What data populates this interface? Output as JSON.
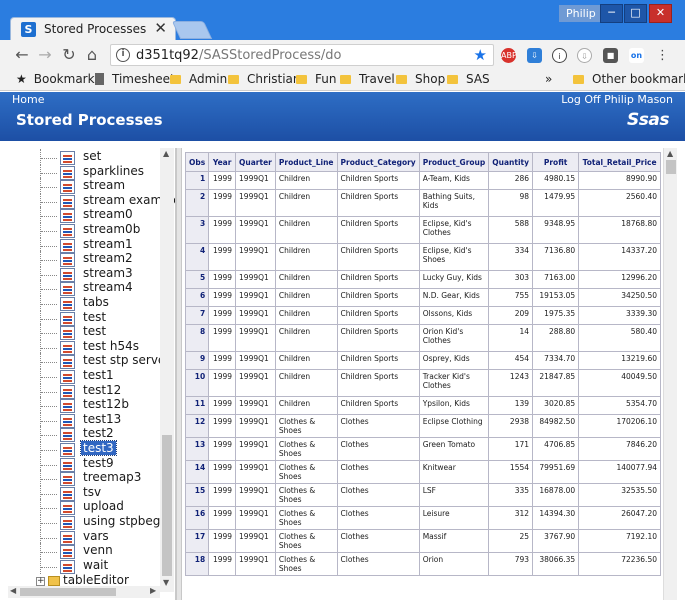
{
  "browser": {
    "tab_title": "Stored Processes",
    "tab_close": "✕",
    "favicon_letter": "S",
    "user": "Philip",
    "url_host": "d351tq92",
    "url_path": "/SASStoredProcess/do",
    "window_controls": [
      "minimize",
      "maximize",
      "close"
    ],
    "nav_icons": [
      "back-arrow-icon",
      "forward-arrow-icon",
      "reload-icon",
      "home-icon"
    ],
    "extensions": [
      "abp-icon",
      "download-icon",
      "info-icon",
      "clock-icon",
      "square-icon",
      "on-icon",
      "menu-icon"
    ]
  },
  "bookmarks": {
    "items": [
      "Bookmarks",
      "Timesheet",
      "Admin",
      "Christian",
      "Fun",
      "Travel",
      "Shop",
      "SAS"
    ],
    "overflow": "»",
    "other": "Other bookmarks"
  },
  "sas": {
    "home_link": "Home",
    "logoff_link": "Log Off Philip Mason",
    "title": "Stored Processes",
    "logo": "Ssas"
  },
  "tree": {
    "items": [
      "set",
      "sparklines",
      "stream",
      "stream example",
      "stream0",
      "stream0b",
      "stream1",
      "stream2",
      "stream3",
      "stream4",
      "tabs",
      "test",
      "test",
      "test h54s",
      "test stp server",
      "test1",
      "test12",
      "test12b",
      "test13",
      "test2",
      "test3",
      "test9",
      "treemap3",
      "tsv",
      "upload",
      "using stpbegin m",
      "vars",
      "venn",
      "wait"
    ],
    "selected": "test3",
    "folder": "tableEditor"
  },
  "table": {
    "columns": [
      "Obs",
      "Year",
      "Quarter",
      "Product_Line",
      "Product_Category",
      "Product_Group",
      "Quantity",
      "Profit",
      "Total_Retail_Price"
    ],
    "rows": [
      [
        "1",
        "1999",
        "1999Q1",
        "Children",
        "Children Sports",
        "A-Team, Kids",
        "286",
        "4980.15",
        "8990.90"
      ],
      [
        "2",
        "1999",
        "1999Q1",
        "Children",
        "Children Sports",
        "Bathing Suits, Kids",
        "98",
        "1479.95",
        "2560.40"
      ],
      [
        "3",
        "1999",
        "1999Q1",
        "Children",
        "Children Sports",
        "Eclipse, Kid's Clothes",
        "588",
        "9348.95",
        "18768.80"
      ],
      [
        "4",
        "1999",
        "1999Q1",
        "Children",
        "Children Sports",
        "Eclipse, Kid's Shoes",
        "334",
        "7136.80",
        "14337.20"
      ],
      [
        "5",
        "1999",
        "1999Q1",
        "Children",
        "Children Sports",
        "Lucky Guy, Kids",
        "303",
        "7163.00",
        "12996.20"
      ],
      [
        "6",
        "1999",
        "1999Q1",
        "Children",
        "Children Sports",
        "N.D. Gear, Kids",
        "755",
        "19153.05",
        "34250.50"
      ],
      [
        "7",
        "1999",
        "1999Q1",
        "Children",
        "Children Sports",
        "Olssons, Kids",
        "209",
        "1975.35",
        "3339.30"
      ],
      [
        "8",
        "1999",
        "1999Q1",
        "Children",
        "Children Sports",
        "Orion Kid's Clothes",
        "14",
        "288.80",
        "580.40"
      ],
      [
        "9",
        "1999",
        "1999Q1",
        "Children",
        "Children Sports",
        "Osprey, Kids",
        "454",
        "7334.70",
        "13219.60"
      ],
      [
        "10",
        "1999",
        "1999Q1",
        "Children",
        "Children Sports",
        "Tracker Kid's Clothes",
        "1243",
        "21847.85",
        "40049.50"
      ],
      [
        "11",
        "1999",
        "1999Q1",
        "Children",
        "Children Sports",
        "Ypsilon, Kids",
        "139",
        "3020.85",
        "5354.70"
      ],
      [
        "12",
        "1999",
        "1999Q1",
        "Clothes & Shoes",
        "Clothes",
        "Eclipse Clothing",
        "2938",
        "84982.50",
        "170206.10"
      ],
      [
        "13",
        "1999",
        "1999Q1",
        "Clothes & Shoes",
        "Clothes",
        "Green Tomato",
        "171",
        "4706.85",
        "7846.20"
      ],
      [
        "14",
        "1999",
        "1999Q1",
        "Clothes & Shoes",
        "Clothes",
        "Knitwear",
        "1554",
        "79951.69",
        "140077.94"
      ],
      [
        "15",
        "1999",
        "1999Q1",
        "Clothes & Shoes",
        "Clothes",
        "LSF",
        "335",
        "16878.00",
        "32535.50"
      ],
      [
        "16",
        "1999",
        "1999Q1",
        "Clothes & Shoes",
        "Clothes",
        "Leisure",
        "312",
        "14394.30",
        "26047.20"
      ],
      [
        "17",
        "1999",
        "1999Q1",
        "Clothes & Shoes",
        "Clothes",
        "Massif",
        "25",
        "3767.90",
        "7192.10"
      ],
      [
        "18",
        "1999",
        "1999Q1",
        "Clothes & Shoes",
        "Clothes",
        "Orion",
        "793",
        "38066.35",
        "72236.50"
      ]
    ]
  },
  "colors": {
    "title_bar": "#2b7de0",
    "sas_header": "#1d4fa5",
    "selection": "#3167c2",
    "table_header_text": "#112277",
    "table_header_bg": "#ececf3"
  }
}
